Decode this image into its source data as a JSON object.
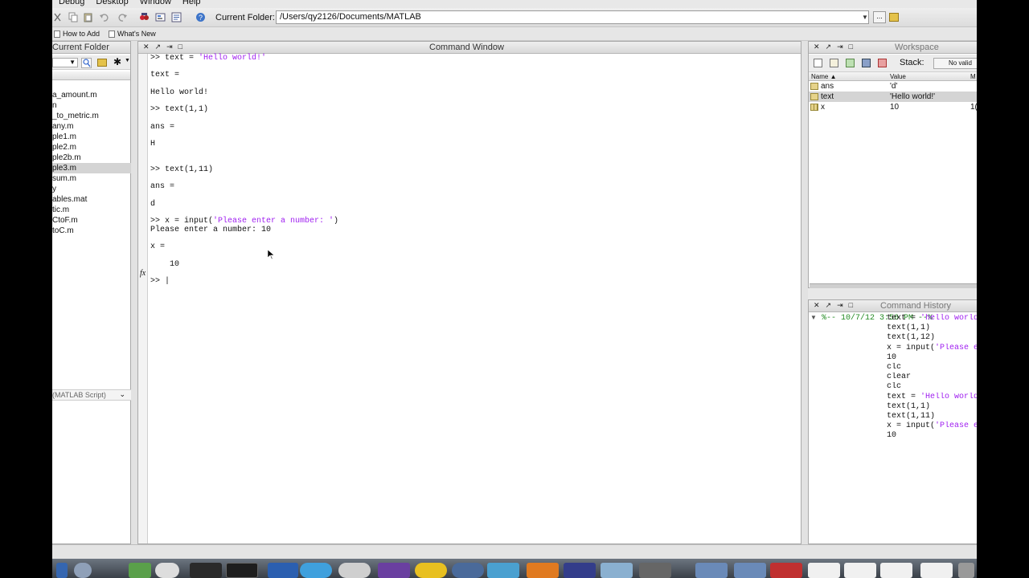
{
  "menu": [
    "Debug",
    "Desktop",
    "Window",
    "Help"
  ],
  "toolbar": {
    "current_folder_label": "Current Folder:",
    "current_folder_path": "/Users/qy2126/Documents/MATLAB",
    "browse_label": "..."
  },
  "shortcuts": [
    "How to Add",
    "What's New"
  ],
  "current_folder_panel": {
    "title": "Current Folder",
    "files": [
      "a_amount.m",
      "n",
      "_to_metric.m",
      "any.m",
      "ple1.m",
      "ple2.m",
      "ple2b.m",
      "ple3.m",
      "sum.m",
      "y",
      "ables.mat",
      "tic.m",
      "CtoF.m",
      "toC.m"
    ],
    "selected_index": 7,
    "details_label": "(MATLAB Script)"
  },
  "command_window": {
    "title": "Command Window",
    "lines": [
      [
        ">> text = ",
        "'Hello world!'"
      ],
      [
        ""
      ],
      [
        "text ="
      ],
      [
        ""
      ],
      [
        "Hello world!"
      ],
      [
        ""
      ],
      [
        ">> text(1,1)"
      ],
      [
        ""
      ],
      [
        "ans ="
      ],
      [
        ""
      ],
      [
        "H"
      ],
      [
        ""
      ],
      [
        ""
      ],
      [
        ">> text(1,11)"
      ],
      [
        ""
      ],
      [
        "ans ="
      ],
      [
        ""
      ],
      [
        "d"
      ],
      [
        ""
      ],
      [
        ">> x = input(",
        "'Please enter a number: '",
        ")"
      ],
      [
        "Please enter a number: 10"
      ],
      [
        ""
      ],
      [
        "x ="
      ],
      [
        ""
      ],
      [
        "    10"
      ],
      [
        ""
      ],
      [
        ">> |"
      ]
    ],
    "fx_label": "fx"
  },
  "workspace": {
    "title": "Workspace",
    "stack_label": "Stack:",
    "no_valid_label": "No valid",
    "columns": [
      "Name ▲",
      "Value",
      "M"
    ],
    "rows": [
      {
        "name": "ans",
        "value": "'d'",
        "extra": ""
      },
      {
        "name": "text",
        "value": "'Hello world!'",
        "extra": ""
      },
      {
        "name": "x",
        "value": "10",
        "extra": "1("
      }
    ],
    "selected_index": 1
  },
  "command_history": {
    "title": "Command History",
    "session_header": "%-- 10/7/12 3:56 PM --%",
    "entries": [
      [
        "text = ",
        "'hello world!'"
      ],
      [
        "text(1,1)"
      ],
      [
        "text(1,12)"
      ],
      [
        "x = input(",
        "'Please enter a num"
      ],
      [
        "10"
      ],
      [
        "clc"
      ],
      [
        "clear"
      ],
      [
        "clc"
      ],
      [
        "text = ",
        "'Hello world!'"
      ],
      [
        "text(1,1)"
      ],
      [
        "text(1,11)"
      ],
      [
        "x = input(",
        "'Please enter a num"
      ],
      [
        "10"
      ]
    ]
  },
  "colors": {
    "string": "#a020f0",
    "session": "#228b22"
  }
}
